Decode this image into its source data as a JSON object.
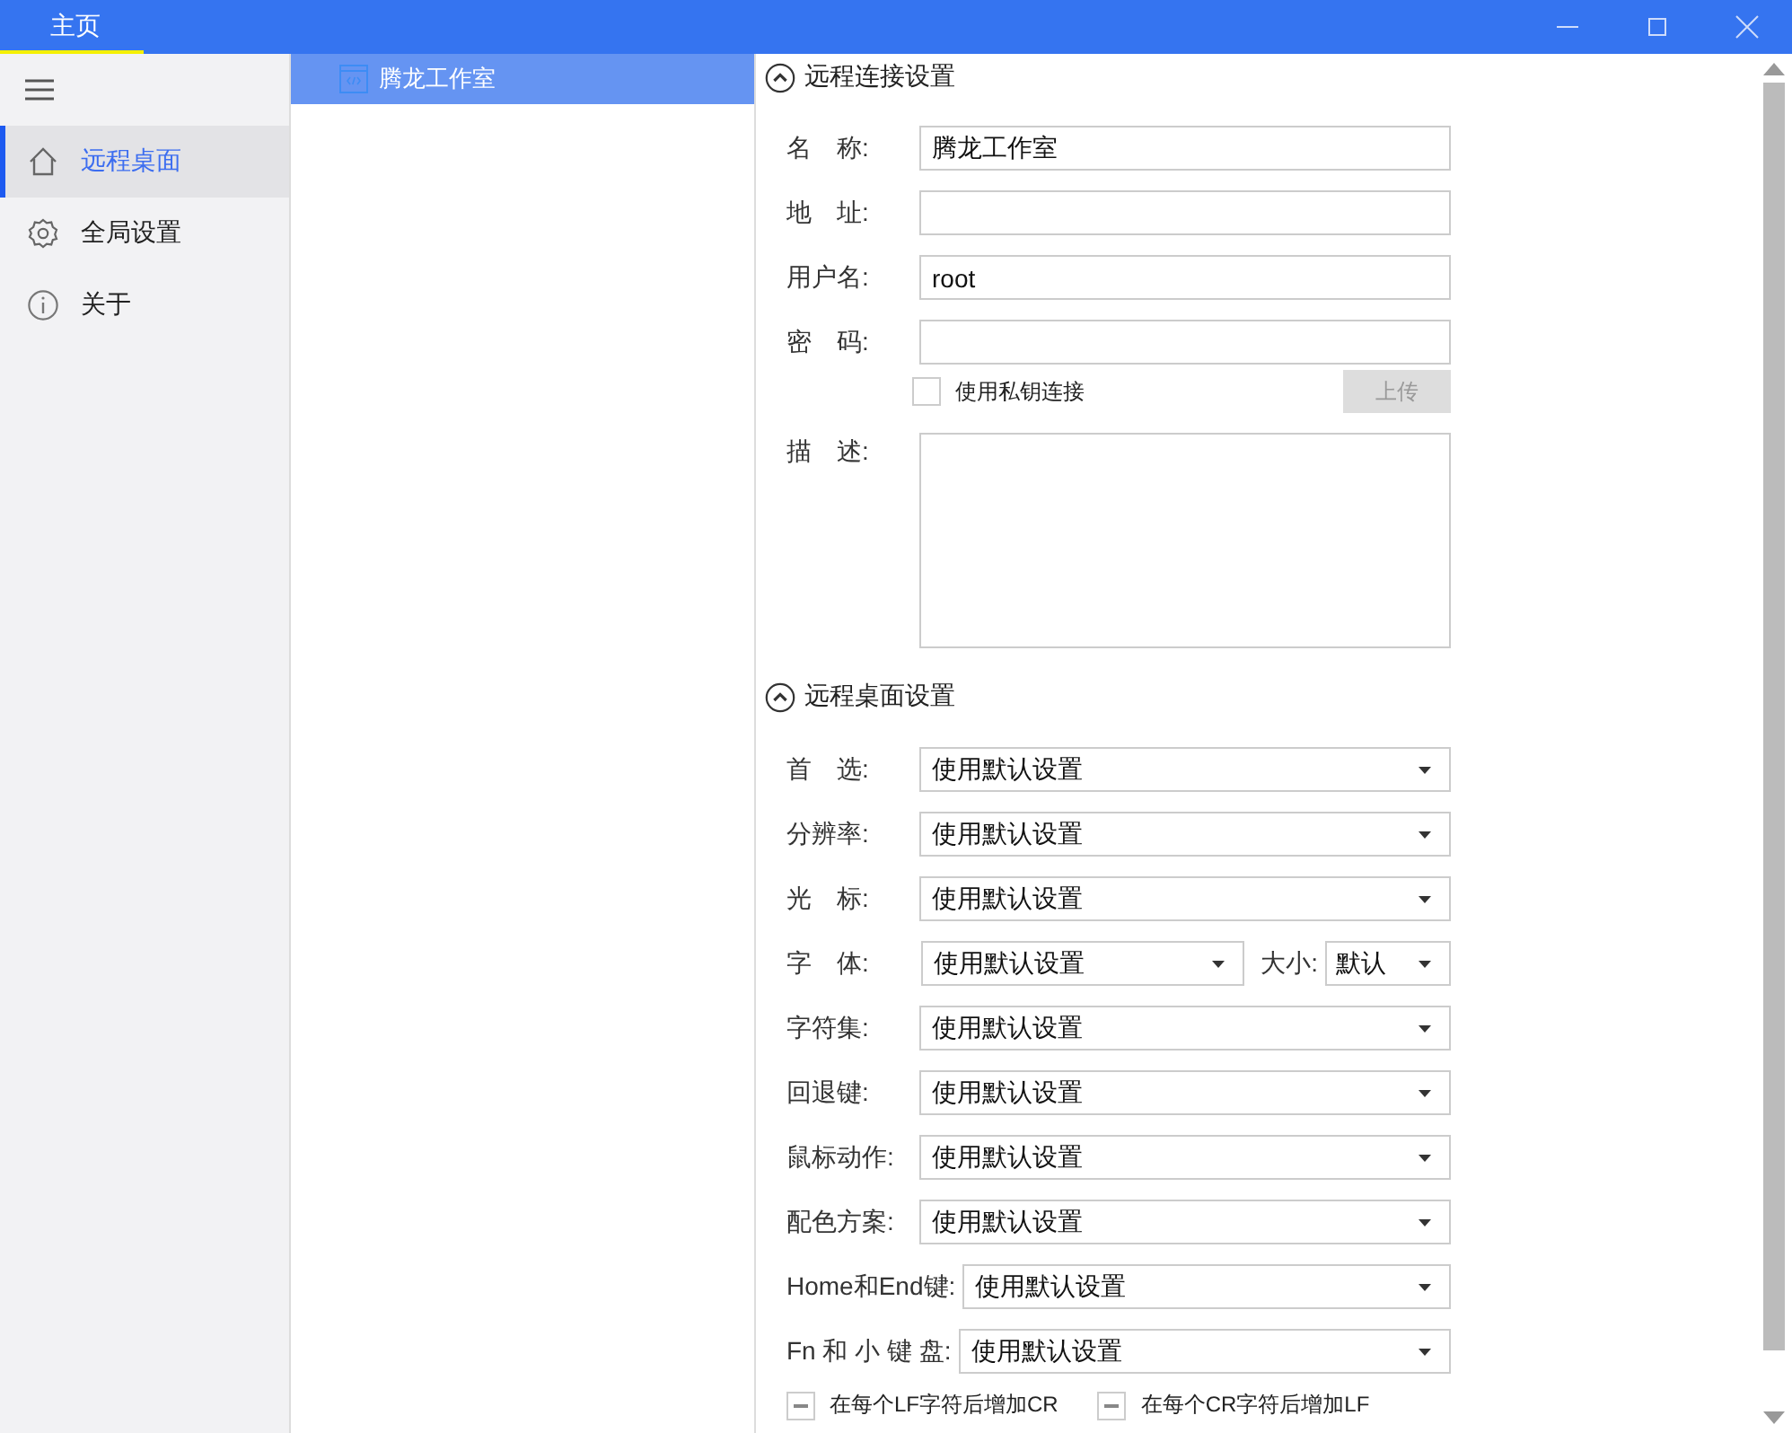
{
  "title_bar": {
    "tabs": [
      {
        "label": "主页",
        "selected": true
      }
    ]
  },
  "sidebar": {
    "items": [
      {
        "kind": "home",
        "label": "远程桌面",
        "selected": true
      },
      {
        "kind": "gear",
        "label": "全局设置",
        "selected": false
      },
      {
        "kind": "info",
        "label": "关于",
        "selected": false
      }
    ]
  },
  "sessions": [
    {
      "label": "腾龙工作室",
      "selected": true
    }
  ],
  "connection_settings": {
    "title": "远程连接设置",
    "expanded": true,
    "fields": [
      {
        "label": "名　称:",
        "value": "腾龙工作室"
      },
      {
        "label": "地　址:"
      },
      {
        "label": "用户名:",
        "value": "root"
      },
      {
        "label": "密　码:"
      }
    ],
    "private_key": {
      "label": "使用私钥连接",
      "checked": false
    },
    "upload_button": {
      "label": "上传",
      "disabled": true
    },
    "description": {
      "label": "描　述:"
    }
  },
  "desktop_settings": {
    "title": "远程桌面设置",
    "expanded": true,
    "fields": [
      {
        "label": "首　选:",
        "value": "使用默认设置"
      },
      {
        "label": "分辨率:",
        "value": "使用默认设置"
      },
      {
        "label": "光　标:",
        "value": "使用默认设置"
      },
      {
        "label": "字　体:",
        "value": "使用默认设置",
        "size": {
          "label": "大小:",
          "value": "默认"
        }
      },
      {
        "label": "字符集:",
        "value": "使用默认设置"
      },
      {
        "label": "回退键:",
        "value": "使用默认设置"
      },
      {
        "label": "鼠标动作:",
        "value": "使用默认设置"
      },
      {
        "label": "配色方案:",
        "value": "使用默认设置"
      },
      {
        "label": "Home和End键:",
        "value": "使用默认设置"
      },
      {
        "label": "Fn 和 小 键 盘:",
        "value": "使用默认设置"
      }
    ],
    "options": [
      {
        "label": "在每个LF字符后增加CR",
        "indeterminate": true
      },
      {
        "label": "在每个CR字符后增加LF",
        "indeterminate": true
      }
    ]
  }
}
